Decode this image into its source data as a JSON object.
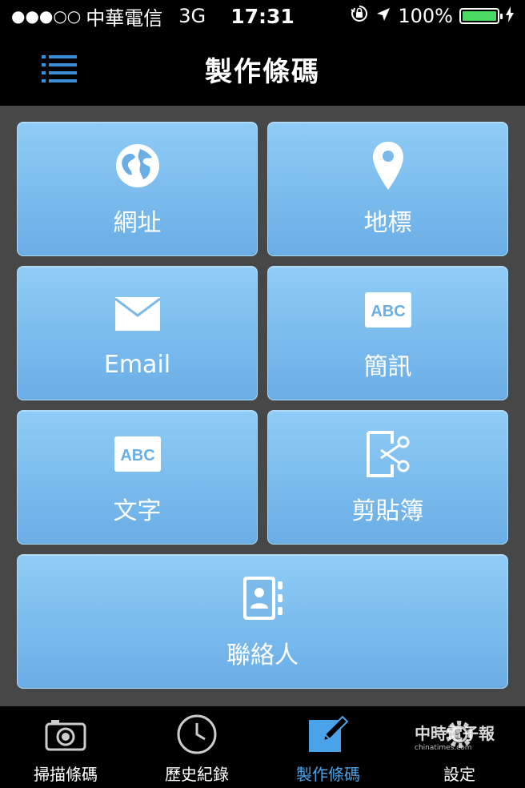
{
  "status_bar": {
    "signal": "●●●○○",
    "carrier": "中華電信",
    "network": "3G",
    "time": "17:31",
    "battery": "100%",
    "battery_level": 1.0,
    "icons": [
      "orientation-lock-icon",
      "location-arrow-icon",
      "battery-icon",
      "charging-icon"
    ]
  },
  "nav": {
    "title": "製作條碼",
    "menu_icon": "menu-icon"
  },
  "tiles": [
    {
      "label": "網址",
      "icon": "globe-icon"
    },
    {
      "label": "地標",
      "icon": "map-pin-icon"
    },
    {
      "label": "Email",
      "icon": "envelope-icon"
    },
    {
      "label": "簡訊",
      "icon": "abc-icon"
    },
    {
      "label": "文字",
      "icon": "abc-icon"
    },
    {
      "label": "剪貼簿",
      "icon": "scissors-icon"
    },
    {
      "label": "聯絡人",
      "icon": "address-book-icon"
    }
  ],
  "tabs": [
    {
      "label": "掃描條碼",
      "icon": "camera-icon",
      "active": false
    },
    {
      "label": "歷史紀錄",
      "icon": "clock-icon",
      "active": false
    },
    {
      "label": "製作條碼",
      "icon": "edit-icon",
      "active": true
    },
    {
      "label": "設定",
      "icon": "gear-icon",
      "active": false
    }
  ],
  "colors": {
    "tile_top": "#8fccf6",
    "tile_bottom": "#6aaee6",
    "background": "#474747",
    "active_tab": "#4aa3e8",
    "menu_icon": "#3a8fd6",
    "battery": "#4cd964"
  },
  "watermark": {
    "main": "中時電子報",
    "sub": "chinatimes.com"
  }
}
